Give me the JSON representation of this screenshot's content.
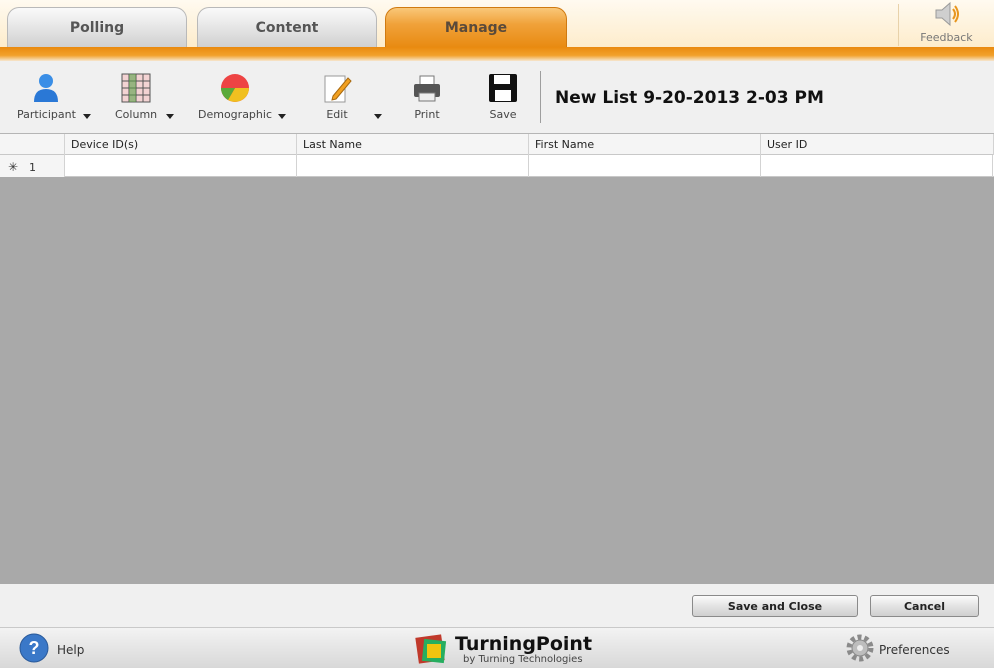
{
  "tabs": [
    {
      "label": "Polling",
      "active": false
    },
    {
      "label": "Content",
      "active": false
    },
    {
      "label": "Manage",
      "active": true
    }
  ],
  "feedback": {
    "label": "Feedback",
    "icon": "speaker-icon"
  },
  "toolbar": {
    "participant": "Participant",
    "column": "Column",
    "demographic": "Demographic",
    "edit": "Edit",
    "print": "Print",
    "save": "Save"
  },
  "list_title": "New List 9-20-2013 2-03 PM",
  "grid": {
    "columns": [
      "Device ID(s)",
      "Last Name",
      "First Name",
      "User ID"
    ],
    "rows": [
      {
        "marker": "✳",
        "number": "1",
        "cells": [
          "",
          "",
          "",
          ""
        ]
      }
    ]
  },
  "actions": {
    "save_close": "Save and Close",
    "cancel": "Cancel"
  },
  "footer": {
    "help": "Help",
    "brand_name": "TurningPoint",
    "brand_sub": "by Turning Technologies",
    "preferences": "Preferences"
  },
  "colors": {
    "accent": "#e88a10",
    "grid_bg": "#a9a9a9"
  }
}
